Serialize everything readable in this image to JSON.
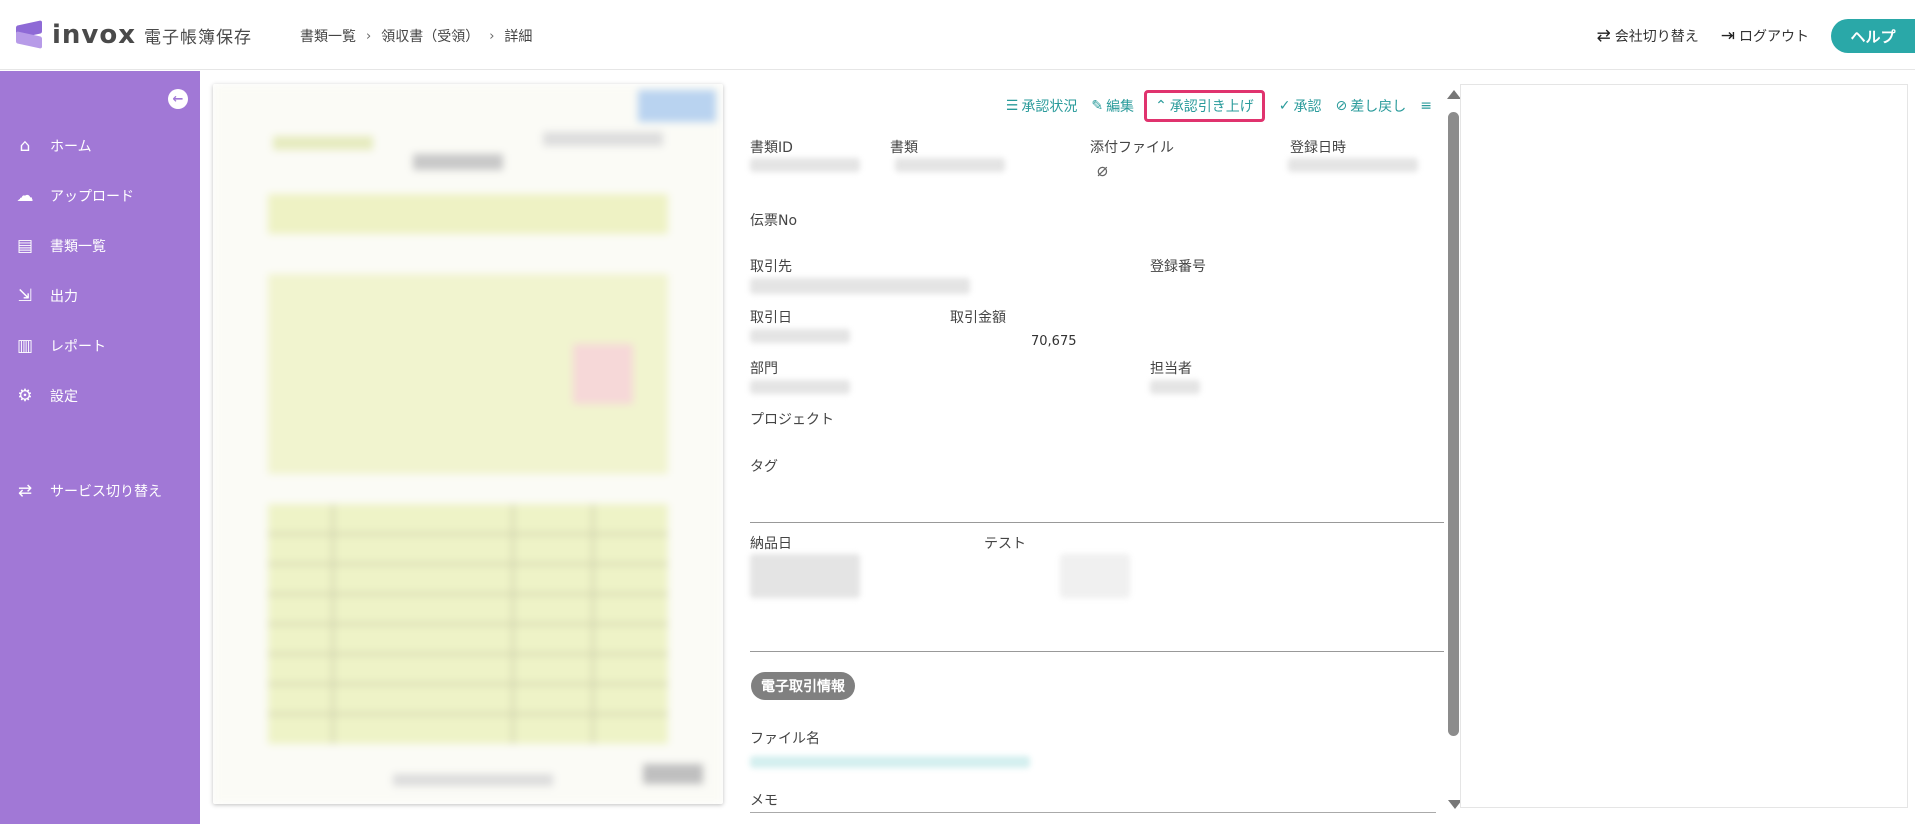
{
  "header": {
    "logo_word": "invox",
    "logo_sub": "電子帳簿保存",
    "breadcrumb": [
      "書類一覧",
      "領収書（受領）",
      "詳細"
    ],
    "company_switch": "会社切り替え",
    "logout": "ログアウト",
    "help": "ヘルプ"
  },
  "sidebar": {
    "items": [
      {
        "label": "ホーム",
        "icon": "home-icon"
      },
      {
        "label": "アップロード",
        "icon": "cloud-upload-icon"
      },
      {
        "label": "書類一覧",
        "icon": "document-icon"
      },
      {
        "label": "出力",
        "icon": "export-icon"
      },
      {
        "label": "レポート",
        "icon": "chart-icon"
      },
      {
        "label": "設定",
        "icon": "gear-icon"
      }
    ],
    "service_switch": "サービス切り替え"
  },
  "toolbar": {
    "status": "承認状況",
    "edit": "編集",
    "raise": "承認引き上げ",
    "approve": "承認",
    "reject": "差し戻し"
  },
  "fields": {
    "doc_id": "書類ID",
    "doc": "書類",
    "attachment": "添付ファイル",
    "reg_date": "登録日時",
    "slip_no": "伝票No",
    "partner": "取引先",
    "reg_number": "登録番号",
    "trade_date": "取引日",
    "amount_label": "取引金額",
    "amount_value": "70,675",
    "department": "部門",
    "person": "担当者",
    "project": "プロジェクト",
    "tag": "タグ",
    "delivery_date": "納品日",
    "test": "テスト",
    "e_trade_badge": "電子取引情報",
    "filename": "ファイル名",
    "memo": "メモ"
  },
  "colors": {
    "sidebar": "#a178d6",
    "accent": "#2aa8a8",
    "highlight": "#e0336e"
  }
}
